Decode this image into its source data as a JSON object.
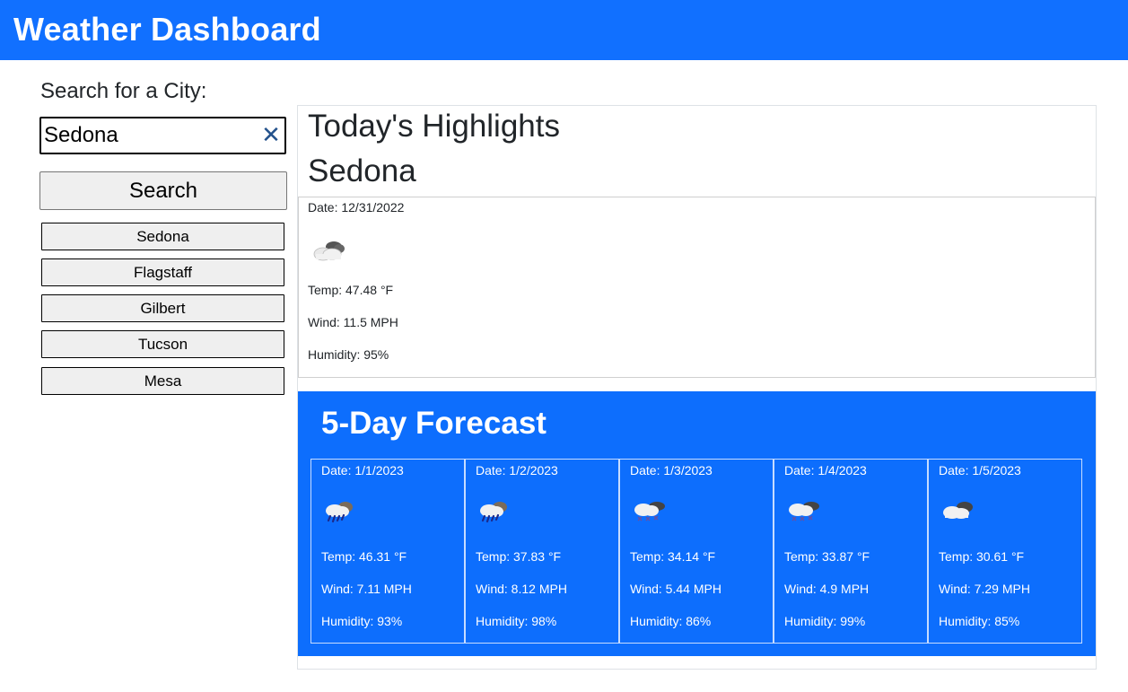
{
  "header": {
    "title": "Weather Dashboard"
  },
  "search": {
    "label": "Search for a City:",
    "value": "Sedona",
    "clear_icon": "close-icon",
    "button_label": "Search"
  },
  "history": [
    "Sedona",
    "Flagstaff",
    "Gilbert",
    "Tucson",
    "Mesa"
  ],
  "today": {
    "heading": "Today's Highlights",
    "city": "Sedona",
    "date": "Date: 12/31/2022",
    "icon": "cloudy-icon",
    "temp": "Temp: 47.48 °F",
    "wind": "Wind: 11.5 MPH",
    "humidity": "Humidity: 95%"
  },
  "forecast": {
    "heading": "5-Day Forecast",
    "days": [
      {
        "date": "Date: 1/1/2023",
        "icon": "rain-cloud-icon",
        "temp": "Temp: 46.31 °F",
        "wind": "Wind: 7.11 MPH",
        "humidity": "Humidity: 93%"
      },
      {
        "date": "Date: 1/2/2023",
        "icon": "rain-cloud-icon",
        "temp": "Temp: 37.83 °F",
        "wind": "Wind: 8.12 MPH",
        "humidity": "Humidity: 98%"
      },
      {
        "date": "Date: 1/3/2023",
        "icon": "snow-cloud-icon",
        "temp": "Temp: 34.14 °F",
        "wind": "Wind: 5.44 MPH",
        "humidity": "Humidity: 86%"
      },
      {
        "date": "Date: 1/4/2023",
        "icon": "snow-cloud-icon",
        "temp": "Temp: 33.87 °F",
        "wind": "Wind: 4.9 MPH",
        "humidity": "Humidity: 99%"
      },
      {
        "date": "Date: 1/5/2023",
        "icon": "cloudy-icon",
        "temp": "Temp: 30.61 °F",
        "wind": "Wind: 7.29 MPH",
        "humidity": "Humidity: 85%"
      }
    ]
  },
  "colors": {
    "header_bg": "#1170ff",
    "forecast_bg": "#0d6efd",
    "clear_icon": "#24528c"
  }
}
